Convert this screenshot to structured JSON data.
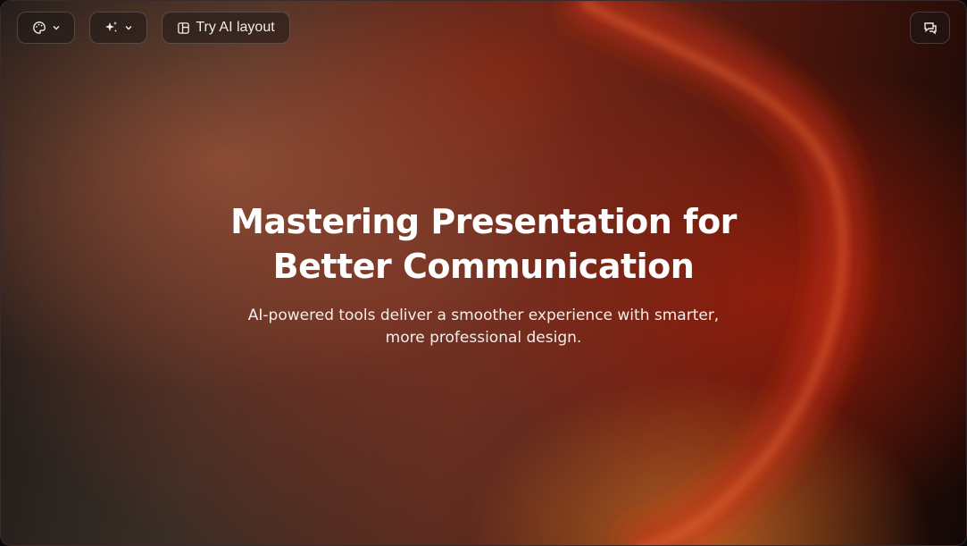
{
  "toolbar": {
    "theme_button_icon": "palette-icon",
    "ai_button_icon": "sparkles-icon",
    "layout_button_label": "Try AI layout",
    "layout_button_icon": "layout-icon",
    "chat_button_icon": "chat-icon"
  },
  "slide": {
    "title_line1": "Mastering Presentation for",
    "title_line2": "Better Communication",
    "subtitle_line1": "AI-powered tools deliver a smoother experience with smarter,",
    "subtitle_line2": "more professional design."
  },
  "colors": {
    "accent_orange": "#d67828",
    "accent_red": "#aa1e0a",
    "text": "#ffffff"
  }
}
